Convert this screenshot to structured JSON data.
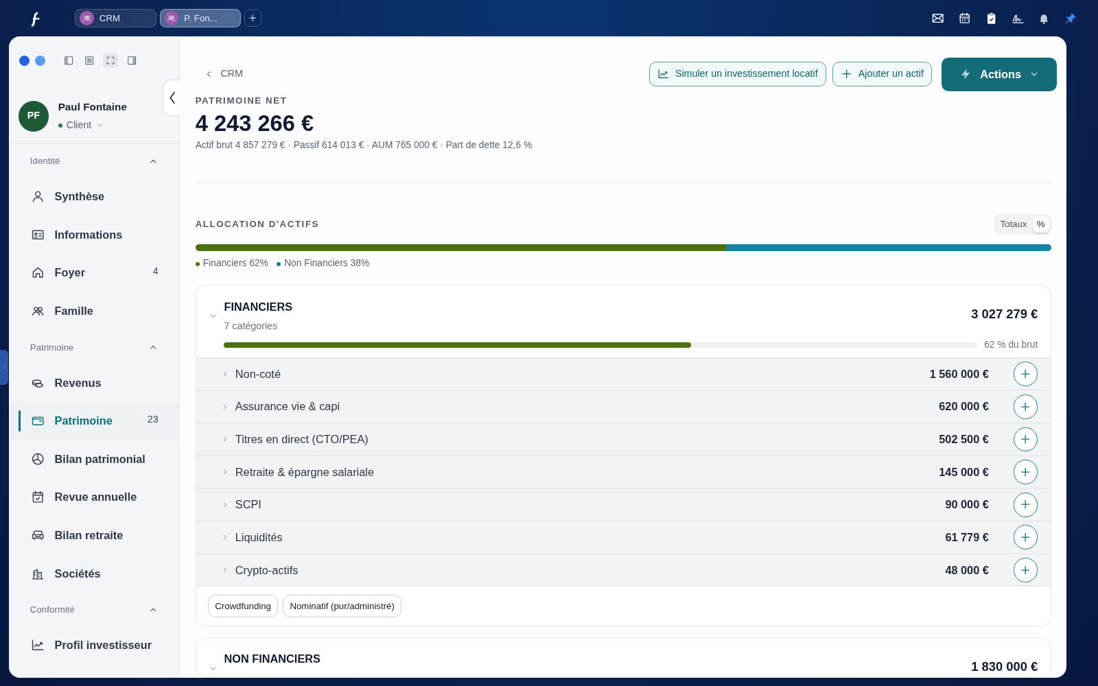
{
  "app_bar": {
    "tabs": [
      {
        "label": "CRM",
        "selected": false
      },
      {
        "label": "P. Fon...",
        "selected": true
      }
    ]
  },
  "sidebar": {
    "profile": {
      "initials": "PF",
      "name": "Paul Fontaine",
      "status": "Client"
    },
    "sections": [
      {
        "title": "Identité",
        "expanded": true,
        "items": [
          {
            "label": "Synthèse",
            "selected": false
          },
          {
            "label": "Informations",
            "selected": false
          },
          {
            "label": "Foyer",
            "count": "4",
            "selected": false
          },
          {
            "label": "Famille",
            "selected": false
          }
        ]
      },
      {
        "title": "Patrimoine",
        "expanded": true,
        "items": [
          {
            "label": "Revenus",
            "selected": false
          },
          {
            "label": "Patrimoine",
            "count": "23",
            "selected": true
          },
          {
            "label": "Bilan patrimonial",
            "selected": false
          },
          {
            "label": "Revue annuelle",
            "selected": false
          },
          {
            "label": "Bilan retraite",
            "selected": false
          },
          {
            "label": "Sociétés",
            "selected": false
          }
        ]
      },
      {
        "title": "Conformité",
        "expanded": true,
        "items": [
          {
            "label": "Profil investisseur",
            "selected": false
          }
        ]
      }
    ]
  },
  "header": {
    "back": "CRM",
    "buttons": [
      "Simuler un investissement locatif",
      "Ajouter un actif"
    ],
    "primary": "Actions"
  },
  "net_worth": {
    "label": "PATRIMOINE NET",
    "value": "4 243 266 €",
    "details": "Actif brut 4 857 279 € · Passif 614 013 € · AUM 765 000 € · Part de dette 12,6 %"
  },
  "allocation": {
    "title": "ALLOCATION D'ACTIFS",
    "toggle": [
      {
        "label": "Totaux",
        "selected": false
      },
      {
        "label": "%",
        "selected": true
      }
    ],
    "segments": [
      {
        "label": "Financiers 62%",
        "level": 0.62,
        "color": "#4f700f"
      },
      {
        "label": "Non Financiers 38%",
        "level": 0.38,
        "color": "#1683a3"
      }
    ]
  },
  "groups": [
    {
      "title": "FINANCIERS",
      "subtitle": "7 catégories",
      "total": "3 027 279 €",
      "expanded": true,
      "level": 0.62,
      "share": "62 % du brut",
      "rows": [
        {
          "label": "Non-coté",
          "amount": "1 560 000 €"
        },
        {
          "label": "Assurance vie & capi",
          "amount": "620 000 €"
        },
        {
          "label": "Titres en direct (CTO/PEA)",
          "amount": "502 500 €"
        },
        {
          "label": "Retraite & épargne salariale",
          "amount": "145 000 €"
        },
        {
          "label": "SCPI",
          "amount": "90 000 €"
        },
        {
          "label": "Liquidités",
          "amount": "61 779 €"
        },
        {
          "label": "Crypto-actifs",
          "amount": "48 000 €"
        }
      ],
      "tags": [
        "Crowdfunding",
        "Nominatif (pur/administré)"
      ]
    },
    {
      "title": "NON FINANCIERS",
      "total": "1 830 000 €",
      "expanded": true
    }
  ]
}
